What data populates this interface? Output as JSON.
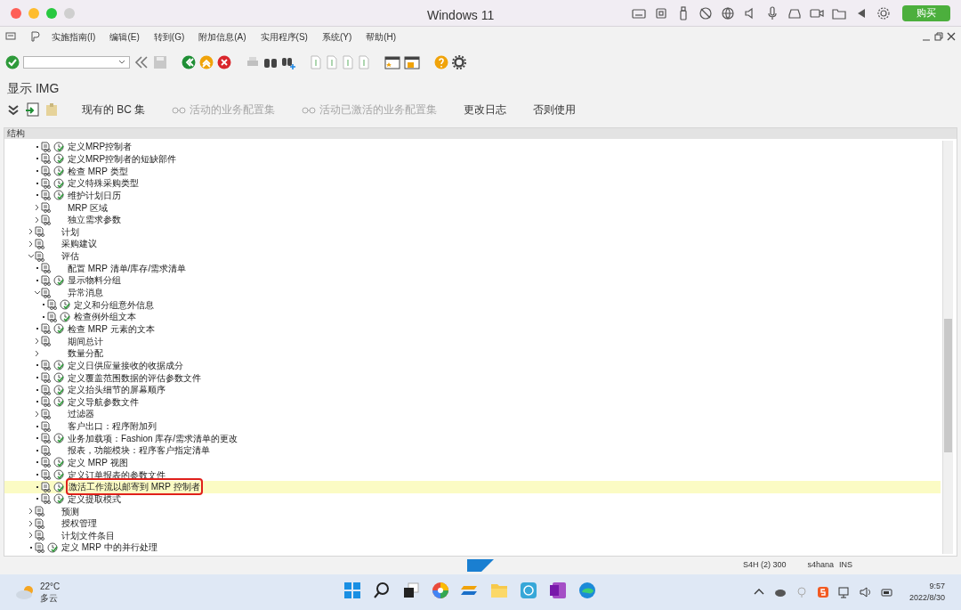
{
  "window": {
    "title": "Windows 11",
    "buy_button": "购买"
  },
  "menu": [
    "实施指南(I)",
    "编辑(E)",
    "转到(G)",
    "附加信息(A)",
    "实用程序(S)",
    "系统(Y)",
    "帮助(H)"
  ],
  "screen_title": "显示 IMG",
  "app_toolbar": [
    {
      "label": "现有的 BC 集",
      "disabled": false,
      "has_icon": false
    },
    {
      "label": "活动的业务配置集",
      "disabled": true,
      "has_icon": true
    },
    {
      "label": "活动已激活的业务配置集",
      "disabled": true,
      "has_icon": true
    },
    {
      "label": "更改日志",
      "disabled": false,
      "has_icon": false
    },
    {
      "label": "否则使用",
      "disabled": false,
      "has_icon": false
    }
  ],
  "tree": {
    "header": "结构",
    "nodes": [
      {
        "children": [
          {
            "label": "定义MRP控制者",
            "kind": "leaf",
            "clock": true,
            "selected": false
          },
          {
            "label": "定义MRP控制者的短缺部件",
            "kind": "leaf",
            "clock": true,
            "selected": false
          },
          {
            "label": "检查 MRP 类型",
            "kind": "leaf",
            "clock": true,
            "selected": false
          },
          {
            "label": "定义特殊采购类型",
            "kind": "leaf",
            "clock": true,
            "selected": false
          },
          {
            "label": "维护计划日历",
            "kind": "leaf",
            "clock": true,
            "selected": false
          },
          {
            "label": "MRP 区域",
            "kind": "folder",
            "expanded": false,
            "doc": true,
            "selected": false
          },
          {
            "label": "独立需求参数",
            "kind": "folder",
            "expanded": false,
            "doc": true,
            "selected": false
          }
        ]
      },
      {
        "label": "计划",
        "kind": "folder",
        "expanded": false,
        "doc": true,
        "selected": false
      },
      {
        "label": "采购建议",
        "kind": "folder",
        "expanded": false,
        "doc": true,
        "selected": false
      },
      {
        "label": "评估",
        "kind": "folder",
        "expanded": true,
        "doc": true,
        "selected": false,
        "children": [
          {
            "label": "配置 MRP 清单/库存/需求清单",
            "kind": "leaf",
            "clock": false,
            "selected": false
          },
          {
            "label": "显示物料分组",
            "kind": "leaf",
            "clock": true,
            "selected": false
          },
          {
            "label": "异常消息",
            "kind": "folder",
            "expanded": true,
            "doc": true,
            "selected": false,
            "children": [
              {
                "label": "定义和分组意外信息",
                "kind": "leaf",
                "clock": true,
                "selected": false
              },
              {
                "label": "检查例外组文本",
                "kind": "leaf",
                "clock": true,
                "selected": false
              }
            ]
          },
          {
            "label": "检查 MRP 元素的文本",
            "kind": "leaf",
            "clock": true,
            "selected": false
          },
          {
            "label": "期间总计",
            "kind": "folder",
            "expanded": false,
            "doc": true,
            "selected": false
          },
          {
            "label": "数量分配",
            "kind": "folder",
            "expanded": false,
            "doc": false,
            "selected": false
          },
          {
            "label": "定义日供应量接收的收据成分",
            "kind": "leaf",
            "clock": true,
            "selected": false
          },
          {
            "label": "定义覆盖范围数据的评估参数文件",
            "kind": "leaf",
            "clock": true,
            "selected": false
          },
          {
            "label": "定义抬头细节的屏幕顺序",
            "kind": "leaf",
            "clock": true,
            "selected": false
          },
          {
            "label": "定义导航参数文件",
            "kind": "leaf",
            "clock": true,
            "selected": false
          },
          {
            "label": "过滤器",
            "kind": "folder",
            "expanded": false,
            "doc": true,
            "selected": false
          },
          {
            "label": "客户出口：程序附加列",
            "kind": "leaf",
            "clock": false,
            "selected": false
          },
          {
            "label": "业务加载项：Fashion 库存/需求清单的更改",
            "kind": "leaf",
            "clock": true,
            "selected": false
          },
          {
            "label": "报表，功能模块：程序客户指定清单",
            "kind": "leaf",
            "clock": false,
            "selected": false
          },
          {
            "label": "定义 MRP 视图",
            "kind": "leaf",
            "clock": true,
            "selected": false
          },
          {
            "label": "定义订单报表的参数文件",
            "kind": "leaf",
            "clock": true,
            "selected": false
          },
          {
            "label": "激活工作流以邮寄到 MRP 控制者",
            "kind": "leaf",
            "clock": true,
            "selected": true
          },
          {
            "label": "定义提取模式",
            "kind": "leaf",
            "clock": true,
            "selected": false
          }
        ]
      },
      {
        "label": "预测",
        "kind": "folder",
        "expanded": false,
        "doc": true,
        "selected": false
      },
      {
        "label": "授权管理",
        "kind": "folder",
        "expanded": false,
        "doc": true,
        "selected": false
      },
      {
        "label": "计划文件条目",
        "kind": "folder",
        "expanded": false,
        "doc": true,
        "selected": false
      },
      {
        "label": "定义 MRP 中的并行处理",
        "kind": "leaf",
        "clock": true,
        "selected": false
      }
    ]
  },
  "status_bar": {
    "system": "S4H (2) 300",
    "server": "s4hana",
    "mode": "INS"
  },
  "taskbar": {
    "temperature": "22°C",
    "weather": "多云",
    "time": "9:57",
    "date": "2022/8/30"
  }
}
